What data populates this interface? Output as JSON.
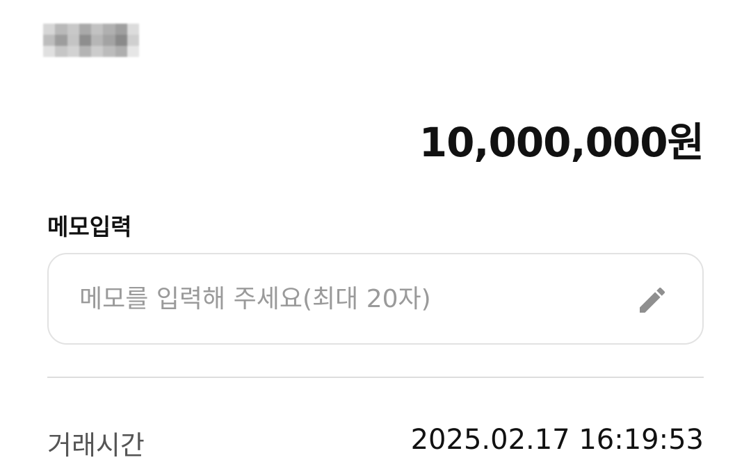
{
  "header": {
    "recipient_name": ""
  },
  "amount": {
    "value": "10,000,000원"
  },
  "memo": {
    "label": "메모입력",
    "placeholder": "메모를 입력해 주세요(최대 20자)",
    "value": "",
    "icon": "pencil-icon"
  },
  "details": {
    "rows": [
      {
        "label": "거래시간",
        "value": "2025.02.17 16:19:53"
      }
    ]
  },
  "colors": {
    "text_primary": "#111111",
    "text_secondary": "#555555",
    "placeholder": "#9a9a9a",
    "border": "#e2e2e2",
    "icon": "#8f8f8f"
  }
}
